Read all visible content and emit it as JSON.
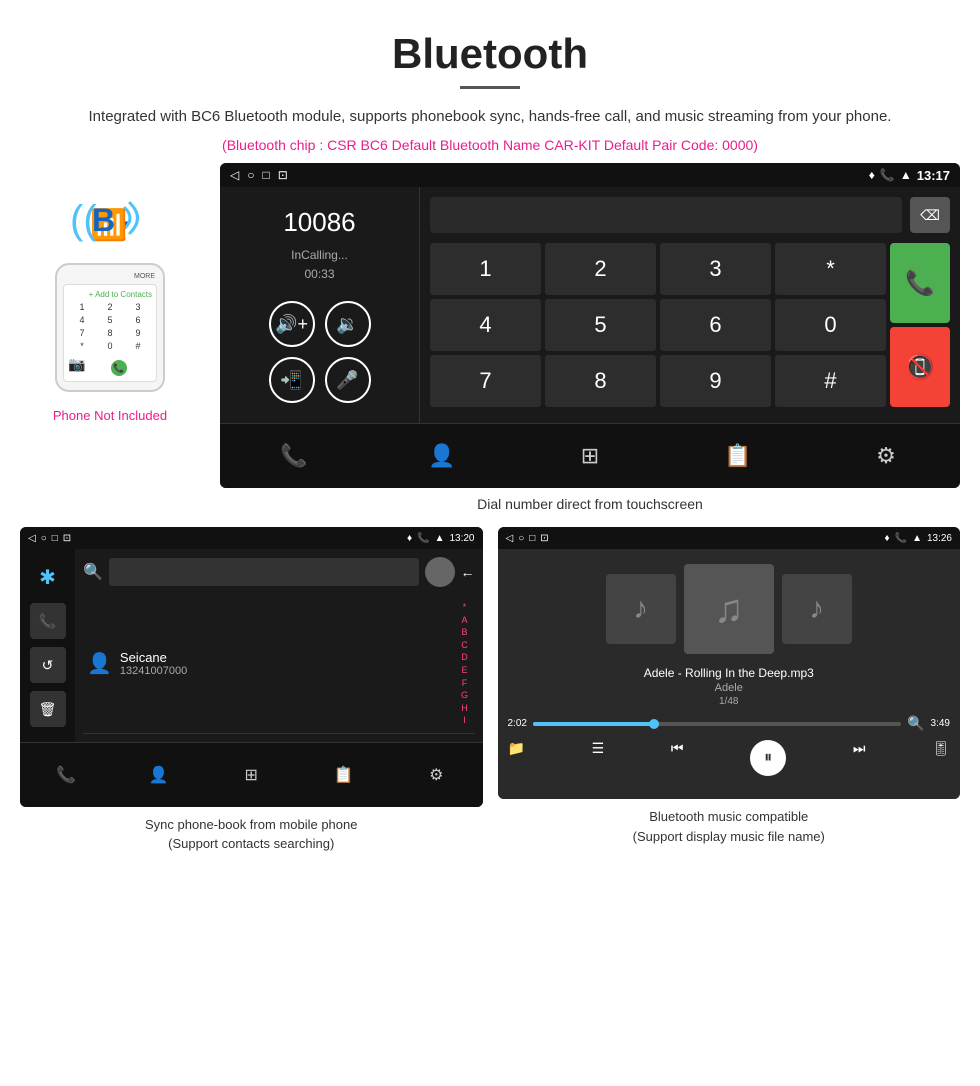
{
  "header": {
    "title": "Bluetooth",
    "description": "Integrated with BC6 Bluetooth module, supports phonebook sync, hands-free call, and music streaming from your phone.",
    "specs": "(Bluetooth chip : CSR BC6    Default Bluetooth Name CAR-KIT    Default Pair Code: 0000)"
  },
  "main_screen": {
    "status_bar": {
      "left_icons": [
        "◁",
        "○",
        "□",
        "⊡"
      ],
      "right_icons": [
        "♦",
        "📞",
        "▲"
      ],
      "time": "13:17"
    },
    "dial": {
      "number": "10086",
      "status": "InCalling...",
      "timer": "00:33",
      "keys": [
        [
          "1",
          "2",
          "3",
          "*"
        ],
        [
          "4",
          "5",
          "6",
          "0"
        ],
        [
          "7",
          "8",
          "9",
          "#"
        ]
      ]
    },
    "caption": "Dial number direct from touchscreen"
  },
  "phonebook_screen": {
    "status_bar": {
      "left_icons": [
        "◁",
        "○",
        "□",
        "⊡"
      ],
      "right_icons": [
        "♦",
        "📞",
        "▲"
      ],
      "time": "13:20"
    },
    "contact": {
      "name": "Seicane",
      "number": "13241007000"
    },
    "alpha_list": [
      "*",
      "A",
      "B",
      "C",
      "D",
      "E",
      "F",
      "G",
      "H",
      "I"
    ],
    "caption_line1": "Sync phone-book from mobile phone",
    "caption_line2": "(Support contacts searching)"
  },
  "music_screen": {
    "status_bar": {
      "left_icons": [
        "◁",
        "○",
        "□",
        "⊡"
      ],
      "right_icons": [
        "♦",
        "📞",
        "▲"
      ],
      "time": "13:26"
    },
    "song_title": "Adele - Rolling In the Deep.mp3",
    "artist": "Adele",
    "track_info": "1/48",
    "time_current": "2:02",
    "time_total": "3:49",
    "progress_percent": 33,
    "caption_line1": "Bluetooth music compatible",
    "caption_line2": "(Support display music file name)"
  },
  "phone_sidebar": {
    "not_included": "Phone Not Included"
  }
}
